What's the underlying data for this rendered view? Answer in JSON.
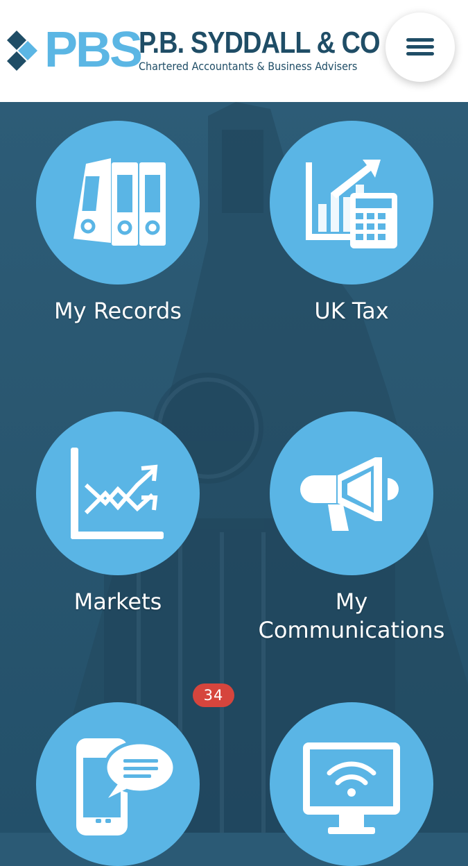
{
  "header": {
    "logo_abbr": "PBS",
    "logo_name": "P.B. SYDDALL & CO",
    "logo_tagline": "Chartered Accountants & Business Advisers",
    "menu_icon": "hamburger-icon"
  },
  "tiles": [
    {
      "label": "My Records",
      "icon": "binders-icon"
    },
    {
      "label": "UK Tax",
      "icon": "tax-chart-calculator-icon"
    },
    {
      "label": "Markets",
      "icon": "market-chart-icon"
    },
    {
      "label": "My\nCommunications",
      "icon": "megaphone-icon"
    },
    {
      "label": "",
      "icon": "mobile-message-icon",
      "badge": "34"
    },
    {
      "label": "",
      "icon": "monitor-wifi-icon"
    }
  ],
  "colors": {
    "header_bg": "#ffffff",
    "brand_light_blue": "#5bb6e4",
    "brand_dark_blue": "#1f4d66",
    "background": "#2b5a75",
    "tile_circle": "#5ab5e5",
    "badge": "#d6453d"
  }
}
